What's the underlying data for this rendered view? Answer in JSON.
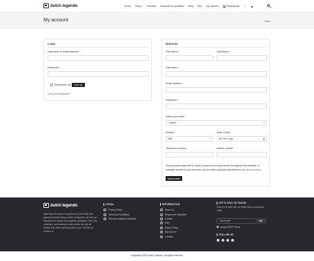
{
  "header": {
    "logo_text": "dutch legends",
    "nav": [
      {
        "label": "Home",
        "caret": false
      },
      {
        "label": "Shop",
        "caret": true
      },
      {
        "label": "Services",
        "caret": false
      },
      {
        "label": "Request for quotation",
        "caret": false
      },
      {
        "label": "Blog",
        "caret": false
      },
      {
        "label": "FAQ",
        "caret": false
      },
      {
        "label": "My account",
        "caret": false
      }
    ],
    "language": "Nederlands"
  },
  "titlebar": {
    "title": "My account",
    "breadcrumb": "Home"
  },
  "login": {
    "heading": "LOGIN",
    "username_label": "Username or email address",
    "password_label": "Password",
    "required_mark": "*",
    "remember_label": "Remember me",
    "submit_label": "LOG IN",
    "lost_password": "Lost your password?"
  },
  "register": {
    "heading": "REGISTER",
    "first_name_label": "First Name",
    "last_name_label": "Last Name",
    "username_label": "Username",
    "email_label": "Email address",
    "password_label": "Password",
    "role_label": "Select your Role",
    "role_value": "-- Select --",
    "gender_label": "Gender",
    "gender_value": "Male",
    "dob_label": "Date of birth",
    "dob_placeholder": "dd / mm / yyyy",
    "telephone_label": "Telephone number",
    "mobile_label": "Mobile number",
    "required_mark": "*",
    "note": "Your personal data will be used to support your experience throughout this website, to manage access to your account, and for other purposes described in our",
    "privacy_link": "privacy policy.",
    "submit_label": "REGISTER"
  },
  "footer": {
    "logo_text": "dutch legends",
    "about": "More than 30 years of experience in the textile and garment manufacturing makes us legends. We use our experience to create new legends worldwide. How? By creating a new business model where we ship all clothes and offer business price to you. Feel free to contact us.",
    "legal_title": "LEGAL",
    "legal_links": [
      "Privacy Policy",
      "Terms and Conditions",
      "General conditions Business"
    ],
    "info_title": "INFORMATION",
    "info_links": [
      "About Us",
      "Request for Quotation",
      "Contact",
      "FAQ",
      "Return Policy",
      "My Account",
      "Location"
    ],
    "stay_title": "LET'S STAY IN TOUCH",
    "stay_text": "Keep up to date with our latest news and special offers.",
    "email_placeholder": "Your Email",
    "go_label": "GO",
    "accept_label": "Accept GDPR Terms",
    "follow_title": "FOLLOW US",
    "social_icons": [
      "twitter-icon",
      "facebook-icon",
      "pinterest-icon",
      "linkedin-icon"
    ]
  },
  "copyright": "Copyright 2023 Dutch Legends. All rights reserved."
}
